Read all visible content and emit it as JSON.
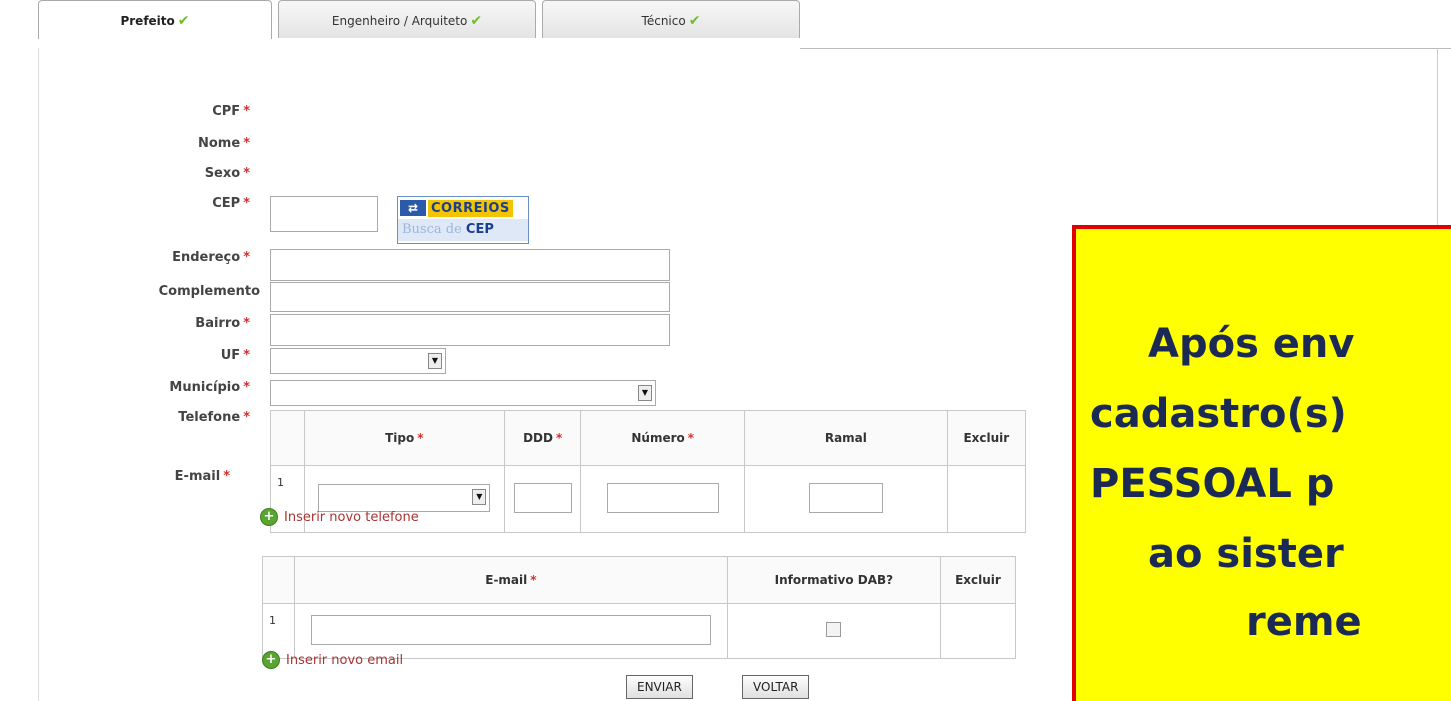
{
  "tabs": [
    {
      "label": "Prefeito",
      "active": true,
      "check": "✔"
    },
    {
      "label": "Engenheiro / Arquiteto",
      "active": false,
      "check": "✔"
    },
    {
      "label": "Técnico",
      "active": false,
      "check": "✔"
    }
  ],
  "required_mark": "*",
  "fields": {
    "cpf": "CPF",
    "nome": "Nome",
    "sexo": "Sexo",
    "cep": "CEP",
    "endereco": "Endereço",
    "complemento": "Complemento",
    "bairro": "Bairro",
    "uf": "UF",
    "municipio": "Município",
    "telefone": "Telefone",
    "email": "E-mail"
  },
  "correios": {
    "brand": "CORREIOS",
    "subtitle_prefix": "Busca de",
    "subtitle_bold": "CEP"
  },
  "phone_table": {
    "headers": {
      "tipo": "Tipo",
      "ddd": "DDD",
      "numero": "Número",
      "ramal": "Ramal",
      "excluir": "Excluir"
    },
    "rows": [
      {
        "num": "1"
      }
    ]
  },
  "add_phone": "Inserir novo telefone",
  "email_table": {
    "headers": {
      "email": "E-mail",
      "informativo": "Informativo DAB?",
      "excluir": "Excluir"
    },
    "rows": [
      {
        "num": "1"
      }
    ]
  },
  "add_email": "Inserir novo email",
  "buttons": {
    "enviar": "ENVIAR",
    "voltar": "VOLTAR"
  },
  "callout": {
    "lines": [
      "Após env",
      "cadastro(s)",
      "PESSOAL p",
      "ao sister",
      "reme"
    ]
  },
  "colors": {
    "required": "#d32f2f",
    "callout_bg": "#ffff00",
    "callout_border": "#e00000",
    "link": "#aa3333"
  }
}
